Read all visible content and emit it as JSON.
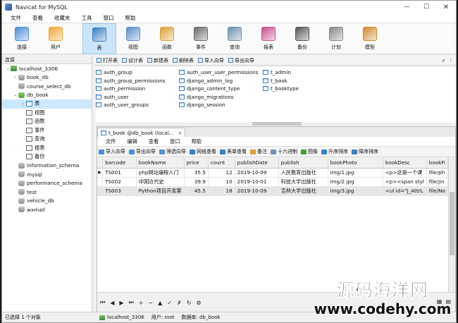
{
  "window": {
    "title": "Navicat for MySQL"
  },
  "menu": [
    "文件",
    "查看",
    "收藏夹",
    "工具",
    "窗口",
    "帮助"
  ],
  "toolbar": [
    {
      "label": "连接",
      "icon": "connection-icon",
      "color": "#4a8fd8"
    },
    {
      "label": "用户",
      "icon": "user-icon",
      "color": "#f0a830"
    },
    {
      "label": "表",
      "icon": "table-icon",
      "color": "#3b7fc4",
      "active": true
    },
    {
      "label": "视图",
      "icon": "view-icon",
      "color": "#5c8fc9"
    },
    {
      "label": "函数",
      "icon": "function-icon",
      "color": "#d9a235"
    },
    {
      "label": "事件",
      "icon": "event-icon",
      "color": "#6b6b6b"
    },
    {
      "label": "查询",
      "icon": "query-icon",
      "color": "#6f8fb0"
    },
    {
      "label": "报表",
      "icon": "report-icon",
      "color": "#c94f8a"
    },
    {
      "label": "备份",
      "icon": "backup-icon",
      "color": "#555555"
    },
    {
      "label": "计划",
      "icon": "schedule-icon",
      "color": "#888888"
    },
    {
      "label": "模型",
      "icon": "model-icon",
      "color": "#d08a2e"
    }
  ],
  "sidebar": {
    "header": "连接",
    "items": [
      {
        "label": "localhost_3306",
        "depth": 0,
        "twisty": "⌄",
        "icon": "server-icon"
      },
      {
        "label": "book_db",
        "depth": 1,
        "twisty": "›",
        "icon": "database-icon"
      },
      {
        "label": "course_select_db",
        "depth": 1,
        "twisty": "",
        "icon": "database-icon"
      },
      {
        "label": "db_book",
        "depth": 1,
        "twisty": "⌄",
        "icon": "database-open-icon"
      },
      {
        "label": "表",
        "depth": 2,
        "twisty": "›",
        "icon": "tables-icon",
        "selected": true
      },
      {
        "label": "视图",
        "depth": 2,
        "twisty": "",
        "icon": "views-icon"
      },
      {
        "label": "函数",
        "depth": 2,
        "twisty": "",
        "icon": "functions-icon"
      },
      {
        "label": "事件",
        "depth": 2,
        "twisty": "",
        "icon": "events-icon"
      },
      {
        "label": "查询",
        "depth": 2,
        "twisty": "",
        "icon": "queries-icon"
      },
      {
        "label": "报表",
        "depth": 2,
        "twisty": "",
        "icon": "reports-icon"
      },
      {
        "label": "备份",
        "depth": 2,
        "twisty": "",
        "icon": "backups-icon"
      },
      {
        "label": "information_schema",
        "depth": 1,
        "twisty": "",
        "icon": "database-icon"
      },
      {
        "label": "mysql",
        "depth": 1,
        "twisty": "",
        "icon": "database-icon"
      },
      {
        "label": "performance_schema",
        "depth": 1,
        "twisty": "",
        "icon": "database-icon"
      },
      {
        "label": "test",
        "depth": 1,
        "twisty": "",
        "icon": "database-icon"
      },
      {
        "label": "vehicle_db",
        "depth": 1,
        "twisty": "",
        "icon": "database-icon"
      },
      {
        "label": "wxmall",
        "depth": 1,
        "twisty": "",
        "icon": "database-icon"
      }
    ]
  },
  "object_toolbar": {
    "buttons": [
      "打开表",
      "设计表",
      "新建表",
      "删除表",
      "导入向导",
      "导出向导"
    ]
  },
  "object_list": {
    "columns": [
      [
        "auth_group",
        "auth_group_permissions",
        "auth_permission",
        "auth_user",
        "auth_user_groups"
      ],
      [
        "auth_user_user_permissions",
        "django_admin_log",
        "django_content_type",
        "django_migrations",
        "django_session"
      ],
      [
        "t_admin",
        "t_book",
        "t_booktype"
      ]
    ]
  },
  "data_window": {
    "tab_title": "t_book @db_book (local...",
    "menu": [
      "文件",
      "编辑",
      "查看",
      "窗口",
      "帮助"
    ],
    "toolbar": [
      "导入向导",
      "导出向导",
      "筛选向导",
      "网格查看",
      "表单查看",
      "备注",
      "十六进制",
      "图像",
      "升序排序",
      "降序排序"
    ],
    "columns": [
      "barcode",
      "bookName",
      "price",
      "count",
      "publishDate",
      "publish",
      "bookPhoto",
      "bookDesc",
      "bookFi"
    ],
    "rows": [
      [
        "TS001",
        "php网站编程入门",
        "35.5",
        "12",
        "2019-10-09",
        "人民教育出版社",
        "img/1.jpg",
        "<p>这是一个课",
        "file/ph"
      ],
      [
        "TS002",
        "中国近代史",
        "39.9",
        "10",
        "2019-10-01",
        "科技大学出版社",
        "img/2.jpg",
        "<p><span styl",
        "file/jin"
      ],
      [
        "TS003",
        "Python项目开发案",
        "45.5",
        "18",
        "2019-10-09",
        "吉林大学出版社",
        "img/3.jpg",
        "<ul id=\"J_AttrL",
        "file/No"
      ]
    ],
    "nav": [
      "⏮",
      "◀",
      "▶",
      "⏭",
      "+",
      "−",
      "▲",
      "✓",
      "✗",
      "↻",
      "⚙"
    ]
  },
  "statusbar": {
    "selection": "已选择 1 个对象",
    "connection": "localhost_3306",
    "user": "用户: root",
    "database": "数据库: db_book"
  },
  "watermark": {
    "line1": "源码海洋网",
    "line2": "www.codehy.com"
  }
}
